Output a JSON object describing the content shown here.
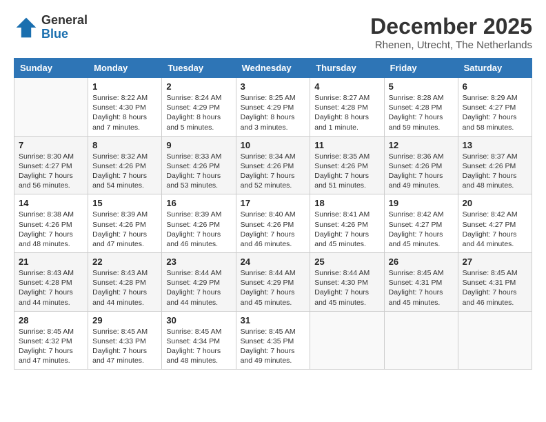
{
  "header": {
    "logo_line1": "General",
    "logo_line2": "Blue",
    "month": "December 2025",
    "location": "Rhenen, Utrecht, The Netherlands"
  },
  "days": [
    "Sunday",
    "Monday",
    "Tuesday",
    "Wednesday",
    "Thursday",
    "Friday",
    "Saturday"
  ],
  "weeks": [
    [
      {
        "date": "",
        "info": ""
      },
      {
        "date": "1",
        "info": "Sunrise: 8:22 AM\nSunset: 4:30 PM\nDaylight: 8 hours\nand 7 minutes."
      },
      {
        "date": "2",
        "info": "Sunrise: 8:24 AM\nSunset: 4:29 PM\nDaylight: 8 hours\nand 5 minutes."
      },
      {
        "date": "3",
        "info": "Sunrise: 8:25 AM\nSunset: 4:29 PM\nDaylight: 8 hours\nand 3 minutes."
      },
      {
        "date": "4",
        "info": "Sunrise: 8:27 AM\nSunset: 4:28 PM\nDaylight: 8 hours\nand 1 minute."
      },
      {
        "date": "5",
        "info": "Sunrise: 8:28 AM\nSunset: 4:28 PM\nDaylight: 7 hours\nand 59 minutes."
      },
      {
        "date": "6",
        "info": "Sunrise: 8:29 AM\nSunset: 4:27 PM\nDaylight: 7 hours\nand 58 minutes."
      }
    ],
    [
      {
        "date": "7",
        "info": "Sunrise: 8:30 AM\nSunset: 4:27 PM\nDaylight: 7 hours\nand 56 minutes."
      },
      {
        "date": "8",
        "info": "Sunrise: 8:32 AM\nSunset: 4:26 PM\nDaylight: 7 hours\nand 54 minutes."
      },
      {
        "date": "9",
        "info": "Sunrise: 8:33 AM\nSunset: 4:26 PM\nDaylight: 7 hours\nand 53 minutes."
      },
      {
        "date": "10",
        "info": "Sunrise: 8:34 AM\nSunset: 4:26 PM\nDaylight: 7 hours\nand 52 minutes."
      },
      {
        "date": "11",
        "info": "Sunrise: 8:35 AM\nSunset: 4:26 PM\nDaylight: 7 hours\nand 51 minutes."
      },
      {
        "date": "12",
        "info": "Sunrise: 8:36 AM\nSunset: 4:26 PM\nDaylight: 7 hours\nand 49 minutes."
      },
      {
        "date": "13",
        "info": "Sunrise: 8:37 AM\nSunset: 4:26 PM\nDaylight: 7 hours\nand 48 minutes."
      }
    ],
    [
      {
        "date": "14",
        "info": "Sunrise: 8:38 AM\nSunset: 4:26 PM\nDaylight: 7 hours\nand 48 minutes."
      },
      {
        "date": "15",
        "info": "Sunrise: 8:39 AM\nSunset: 4:26 PM\nDaylight: 7 hours\nand 47 minutes."
      },
      {
        "date": "16",
        "info": "Sunrise: 8:39 AM\nSunset: 4:26 PM\nDaylight: 7 hours\nand 46 minutes."
      },
      {
        "date": "17",
        "info": "Sunrise: 8:40 AM\nSunset: 4:26 PM\nDaylight: 7 hours\nand 46 minutes."
      },
      {
        "date": "18",
        "info": "Sunrise: 8:41 AM\nSunset: 4:26 PM\nDaylight: 7 hours\nand 45 minutes."
      },
      {
        "date": "19",
        "info": "Sunrise: 8:42 AM\nSunset: 4:27 PM\nDaylight: 7 hours\nand 45 minutes."
      },
      {
        "date": "20",
        "info": "Sunrise: 8:42 AM\nSunset: 4:27 PM\nDaylight: 7 hours\nand 44 minutes."
      }
    ],
    [
      {
        "date": "21",
        "info": "Sunrise: 8:43 AM\nSunset: 4:28 PM\nDaylight: 7 hours\nand 44 minutes."
      },
      {
        "date": "22",
        "info": "Sunrise: 8:43 AM\nSunset: 4:28 PM\nDaylight: 7 hours\nand 44 minutes."
      },
      {
        "date": "23",
        "info": "Sunrise: 8:44 AM\nSunset: 4:29 PM\nDaylight: 7 hours\nand 44 minutes."
      },
      {
        "date": "24",
        "info": "Sunrise: 8:44 AM\nSunset: 4:29 PM\nDaylight: 7 hours\nand 45 minutes."
      },
      {
        "date": "25",
        "info": "Sunrise: 8:44 AM\nSunset: 4:30 PM\nDaylight: 7 hours\nand 45 minutes."
      },
      {
        "date": "26",
        "info": "Sunrise: 8:45 AM\nSunset: 4:31 PM\nDaylight: 7 hours\nand 45 minutes."
      },
      {
        "date": "27",
        "info": "Sunrise: 8:45 AM\nSunset: 4:31 PM\nDaylight: 7 hours\nand 46 minutes."
      }
    ],
    [
      {
        "date": "28",
        "info": "Sunrise: 8:45 AM\nSunset: 4:32 PM\nDaylight: 7 hours\nand 47 minutes."
      },
      {
        "date": "29",
        "info": "Sunrise: 8:45 AM\nSunset: 4:33 PM\nDaylight: 7 hours\nand 47 minutes."
      },
      {
        "date": "30",
        "info": "Sunrise: 8:45 AM\nSunset: 4:34 PM\nDaylight: 7 hours\nand 48 minutes."
      },
      {
        "date": "31",
        "info": "Sunrise: 8:45 AM\nSunset: 4:35 PM\nDaylight: 7 hours\nand 49 minutes."
      },
      {
        "date": "",
        "info": ""
      },
      {
        "date": "",
        "info": ""
      },
      {
        "date": "",
        "info": ""
      }
    ]
  ]
}
